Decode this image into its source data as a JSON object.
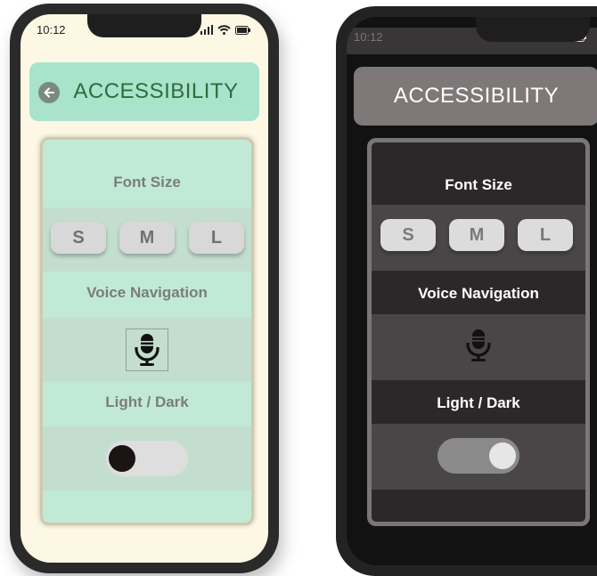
{
  "status_bar": {
    "time": "10:12"
  },
  "header": {
    "title": "ACCESSIBILITY"
  },
  "settings": {
    "font_size_label": "Font Size",
    "font_sizes": [
      "S",
      "M",
      "L"
    ],
    "voice_navigation_label": "Voice Navigation",
    "theme_label": "Light / Dark"
  },
  "themes": {
    "light": {
      "toggle_state": "off",
      "accent": "#a9e3cc",
      "card": "#c1ead6",
      "background": "#fdf8e4"
    },
    "dark": {
      "toggle_state": "on",
      "accent": "#7e7878",
      "card": "#2c2829",
      "background": "#121212"
    }
  },
  "icons": [
    "back-arrow-icon",
    "signal-icon",
    "wifi-icon",
    "battery-icon",
    "microphone-icon"
  ]
}
